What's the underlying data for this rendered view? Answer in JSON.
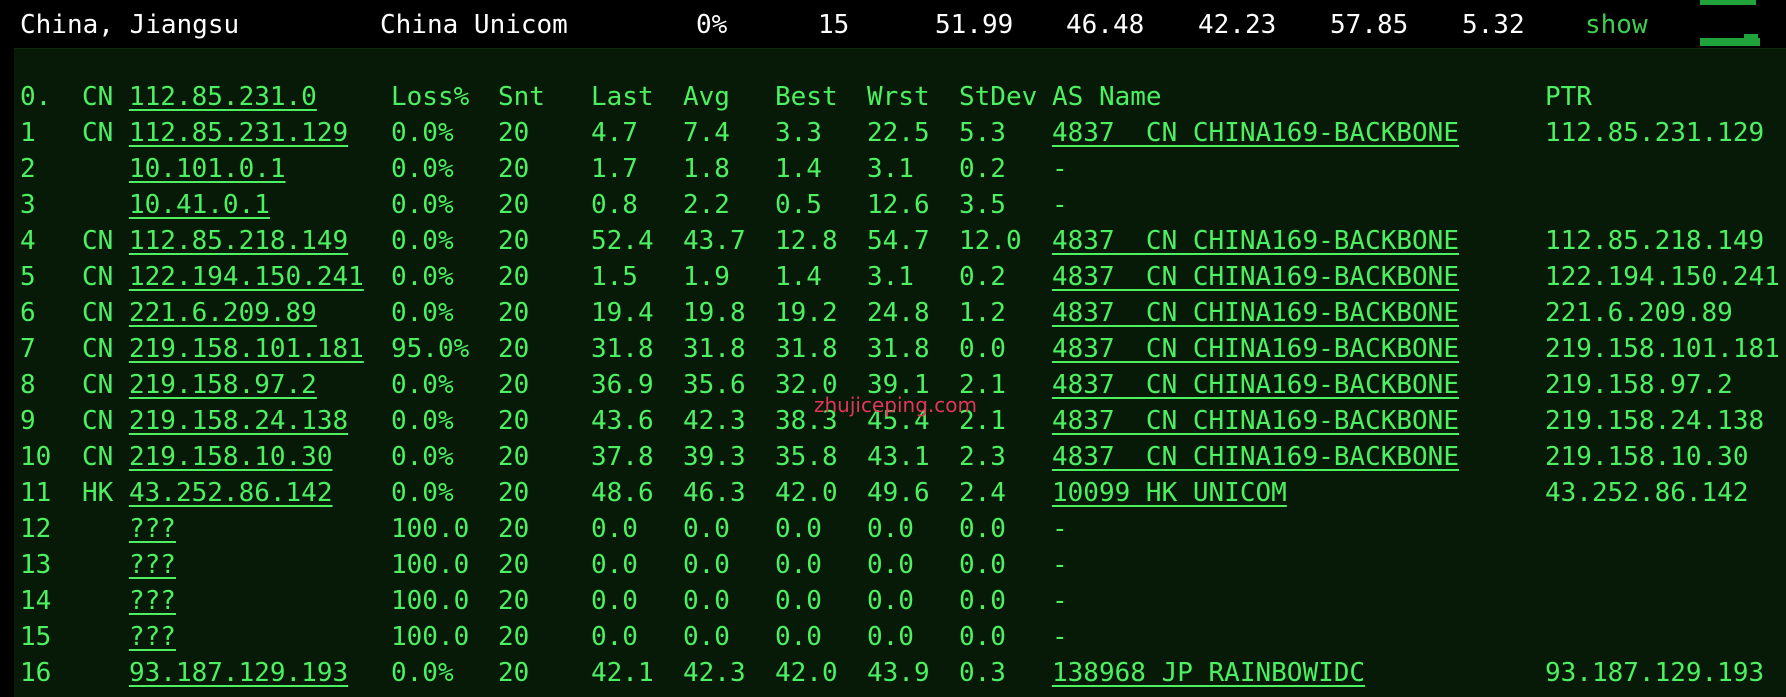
{
  "summary": {
    "location": "China, Jiangsu",
    "isp": "China Unicom",
    "loss": "0%",
    "sent": "15",
    "last": "51.99",
    "avg": "46.48",
    "best": "42.23",
    "worst": "57.85",
    "stdev": "5.32",
    "show_label": "show"
  },
  "table": {
    "header": {
      "hop": "0.",
      "cc": "CN",
      "host": "112.85.231.0",
      "loss": "Loss%",
      "snt": "Snt",
      "last": "Last",
      "avg": "Avg",
      "best": "Best",
      "wrst": "Wrst",
      "stdev": "StDev",
      "asname": "AS Name",
      "ptr": "PTR"
    },
    "rows": [
      {
        "hop": "1",
        "cc": "CN",
        "host": "112.85.231.129",
        "loss": "0.0%",
        "snt": "20",
        "last": "4.7",
        "avg": "7.4",
        "best": "3.3",
        "wrst": "22.5",
        "stdev": "5.3",
        "asname": "4837  CN CHINA169-BACKBONE",
        "ptr": "112.85.231.129"
      },
      {
        "hop": "2",
        "cc": "",
        "host": "10.101.0.1",
        "loss": "0.0%",
        "snt": "20",
        "last": "1.7",
        "avg": "1.8",
        "best": "1.4",
        "wrst": "3.1",
        "stdev": "0.2",
        "asname": "-",
        "ptr": ""
      },
      {
        "hop": "3",
        "cc": "",
        "host": "10.41.0.1",
        "loss": "0.0%",
        "snt": "20",
        "last": "0.8",
        "avg": "2.2",
        "best": "0.5",
        "wrst": "12.6",
        "stdev": "3.5",
        "asname": "-",
        "ptr": ""
      },
      {
        "hop": "4",
        "cc": "CN",
        "host": "112.85.218.149",
        "loss": "0.0%",
        "snt": "20",
        "last": "52.4",
        "avg": "43.7",
        "best": "12.8",
        "wrst": "54.7",
        "stdev": "12.0",
        "asname": "4837  CN CHINA169-BACKBONE",
        "ptr": "112.85.218.149"
      },
      {
        "hop": "5",
        "cc": "CN",
        "host": "122.194.150.241",
        "loss": "0.0%",
        "snt": "20",
        "last": "1.5",
        "avg": "1.9",
        "best": "1.4",
        "wrst": "3.1",
        "stdev": "0.2",
        "asname": "4837  CN CHINA169-BACKBONE",
        "ptr": "122.194.150.241"
      },
      {
        "hop": "6",
        "cc": "CN",
        "host": "221.6.209.89",
        "loss": "0.0%",
        "snt": "20",
        "last": "19.4",
        "avg": "19.8",
        "best": "19.2",
        "wrst": "24.8",
        "stdev": "1.2",
        "asname": "4837  CN CHINA169-BACKBONE",
        "ptr": "221.6.209.89"
      },
      {
        "hop": "7",
        "cc": "CN",
        "host": "219.158.101.181",
        "loss": "95.0%",
        "snt": "20",
        "last": "31.8",
        "avg": "31.8",
        "best": "31.8",
        "wrst": "31.8",
        "stdev": "0.0",
        "asname": "4837  CN CHINA169-BACKBONE",
        "ptr": "219.158.101.181"
      },
      {
        "hop": "8",
        "cc": "CN",
        "host": "219.158.97.2",
        "loss": "0.0%",
        "snt": "20",
        "last": "36.9",
        "avg": "35.6",
        "best": "32.0",
        "wrst": "39.1",
        "stdev": "2.1",
        "asname": "4837  CN CHINA169-BACKBONE",
        "ptr": "219.158.97.2"
      },
      {
        "hop": "9",
        "cc": "CN",
        "host": "219.158.24.138",
        "loss": "0.0%",
        "snt": "20",
        "last": "43.6",
        "avg": "42.3",
        "best": "38.3",
        "wrst": "45.4",
        "stdev": "2.1",
        "asname": "4837  CN CHINA169-BACKBONE",
        "ptr": "219.158.24.138"
      },
      {
        "hop": "10",
        "cc": "CN",
        "host": "219.158.10.30",
        "loss": "0.0%",
        "snt": "20",
        "last": "37.8",
        "avg": "39.3",
        "best": "35.8",
        "wrst": "43.1",
        "stdev": "2.3",
        "asname": "4837  CN CHINA169-BACKBONE",
        "ptr": "219.158.10.30"
      },
      {
        "hop": "11",
        "cc": "HK",
        "host": "43.252.86.142",
        "loss": "0.0%",
        "snt": "20",
        "last": "48.6",
        "avg": "46.3",
        "best": "42.0",
        "wrst": "49.6",
        "stdev": "2.4",
        "asname": "10099 HK UNICOM",
        "ptr": "43.252.86.142"
      },
      {
        "hop": "12",
        "cc": "",
        "host": "???",
        "loss": "100.0",
        "snt": "20",
        "last": "0.0",
        "avg": "0.0",
        "best": "0.0",
        "wrst": "0.0",
        "stdev": "0.0",
        "asname": "-",
        "ptr": ""
      },
      {
        "hop": "13",
        "cc": "",
        "host": "???",
        "loss": "100.0",
        "snt": "20",
        "last": "0.0",
        "avg": "0.0",
        "best": "0.0",
        "wrst": "0.0",
        "stdev": "0.0",
        "asname": "-",
        "ptr": ""
      },
      {
        "hop": "14",
        "cc": "",
        "host": "???",
        "loss": "100.0",
        "snt": "20",
        "last": "0.0",
        "avg": "0.0",
        "best": "0.0",
        "wrst": "0.0",
        "stdev": "0.0",
        "asname": "-",
        "ptr": ""
      },
      {
        "hop": "15",
        "cc": "",
        "host": "???",
        "loss": "100.0",
        "snt": "20",
        "last": "0.0",
        "avg": "0.0",
        "best": "0.0",
        "wrst": "0.0",
        "stdev": "0.0",
        "asname": "-",
        "ptr": ""
      },
      {
        "hop": "16",
        "cc": "",
        "host": "93.187.129.193",
        "loss": "0.0%",
        "snt": "20",
        "last": "42.1",
        "avg": "42.3",
        "best": "42.0",
        "wrst": "43.9",
        "stdev": "0.3",
        "asname": "138968 JP RAINBOWIDC",
        "ptr": "93.187.129.193"
      }
    ]
  },
  "watermark": "zhujiceping.com",
  "colors": {
    "text_green": "#4cf061",
    "panel_bg": "#071a07",
    "summary_text": "#ffffff",
    "show_green": "#3ecf52",
    "watermark": "#e4345a"
  }
}
